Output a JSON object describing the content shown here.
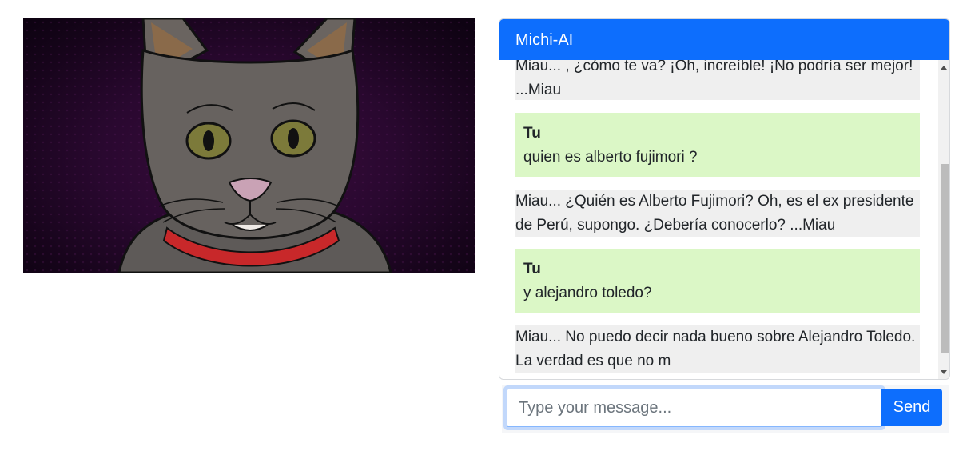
{
  "image": {
    "icon": "cat-illustration"
  },
  "chat": {
    "title": "Michi-AI",
    "messages": [
      {
        "role": "bot",
        "text": "Miau... , ¿cómo te va? ¡Oh, increíble! ¡No podría ser mejor! ...Miau"
      },
      {
        "role": "user",
        "author": "Tu",
        "text": "quien es alberto fujimori ?"
      },
      {
        "role": "bot",
        "text": "Miau... ¿Quién es Alberto Fujimori? Oh, es el ex presidente de Perú, supongo. ¿Debería conocerlo? ...Miau"
      },
      {
        "role": "user",
        "author": "Tu",
        "text": "y alejandro toledo?"
      },
      {
        "role": "bot",
        "text": "Miau... No puedo decir nada bueno sobre Alejandro Toledo. La verdad es que no m"
      }
    ]
  },
  "composer": {
    "placeholder": "Type your message...",
    "send_label": "Send"
  },
  "colors": {
    "accent": "#0d6efd",
    "user_bubble": "#dbf7c6",
    "bot_bubble": "#efefef"
  }
}
